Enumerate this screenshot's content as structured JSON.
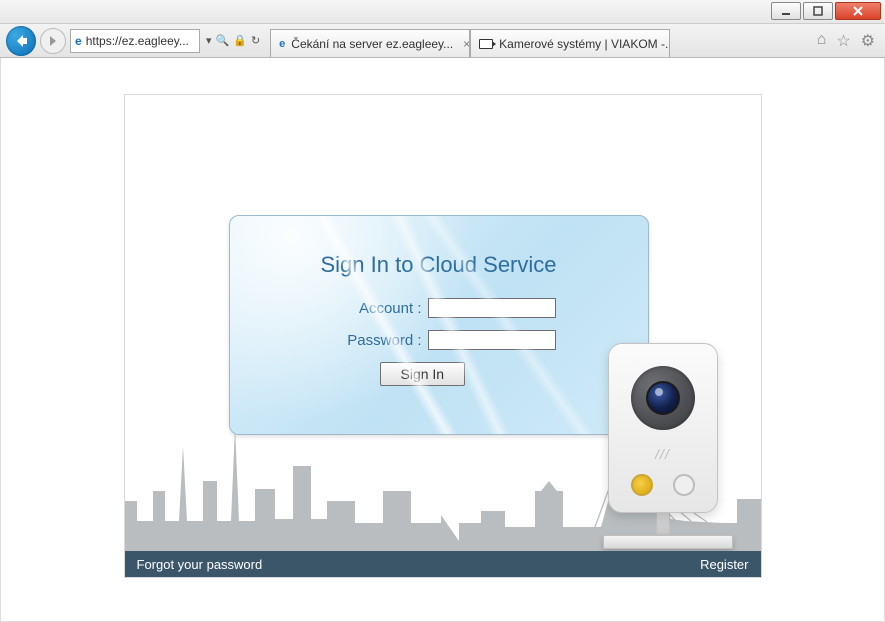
{
  "window": {
    "title_hint": ""
  },
  "browser": {
    "url": "https://ez.eagleey...",
    "tabs": [
      {
        "label": "Čekání na server ez.eagleey..."
      },
      {
        "label": "Kamerové systémy | VIAKOM -..."
      }
    ]
  },
  "login": {
    "title": "Sign In to Cloud Service",
    "account_label": "Account :",
    "password_label": "Password :",
    "account_value": "",
    "password_value": "",
    "signin_label": "Sign In"
  },
  "footer": {
    "forgot": "Forgot your password",
    "register": "Register"
  }
}
